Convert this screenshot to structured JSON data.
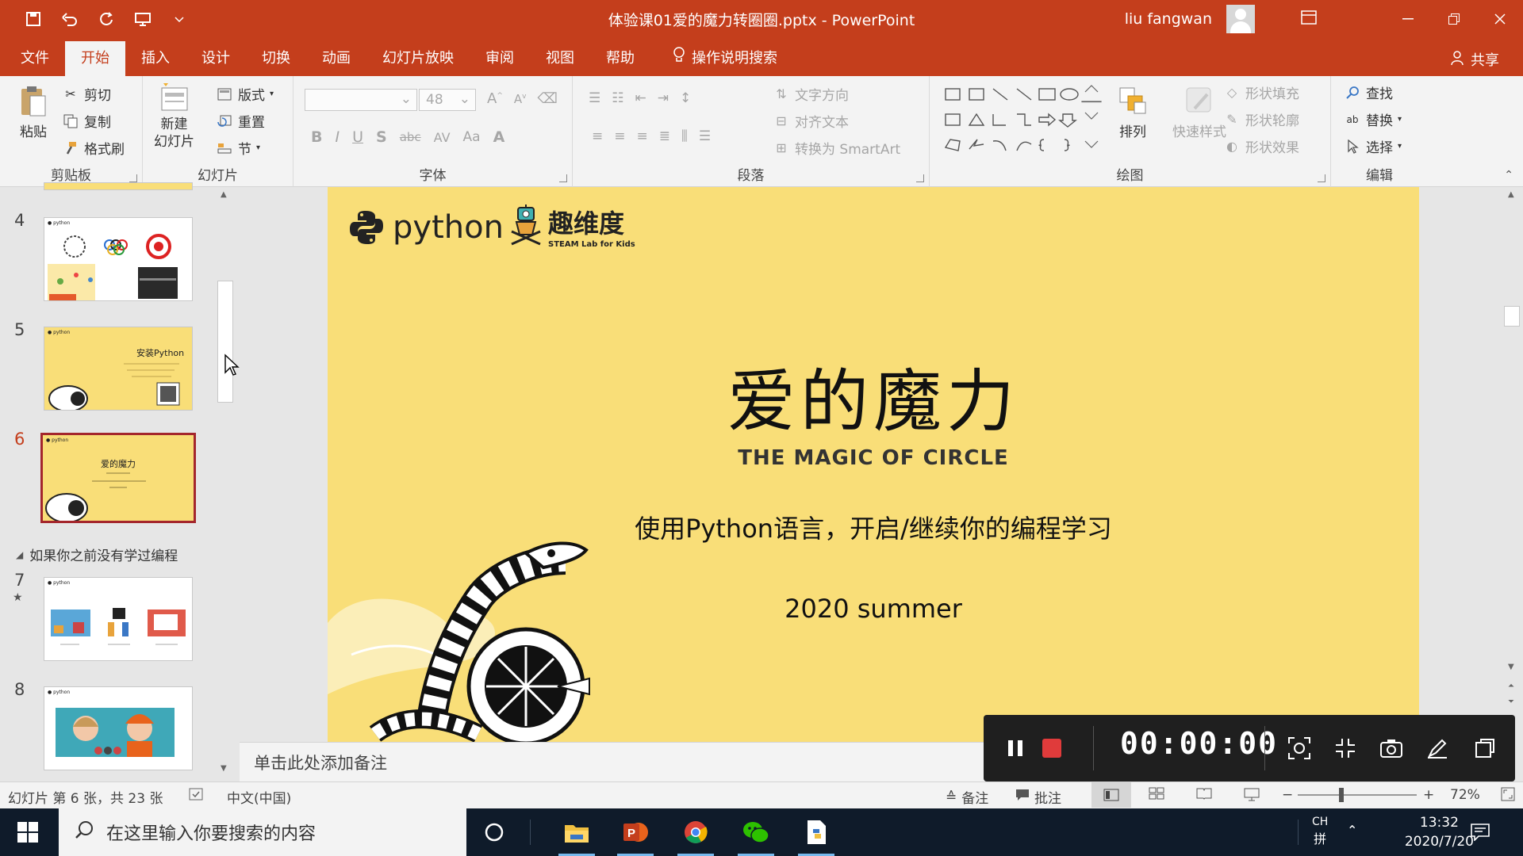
{
  "title_bar": {
    "document_title": "体验课01爱的魔力转圈圈.pptx  -  PowerPoint",
    "user_name": "liu fangwan"
  },
  "menu": {
    "tabs": [
      "文件",
      "开始",
      "插入",
      "设计",
      "切换",
      "动画",
      "幻灯片放映",
      "审阅",
      "视图",
      "帮助"
    ],
    "active_tab": "开始",
    "tell_me": "操作说明搜索",
    "share": "共享"
  },
  "ribbon": {
    "clipboard": {
      "paste": "粘贴",
      "cut": "剪切",
      "copy": "复制",
      "format_painter": "格式刷",
      "label": "剪贴板"
    },
    "slides": {
      "new_slide_line1": "新建",
      "new_slide_line2": "幻灯片",
      "layout": "版式",
      "reset": "重置",
      "section": "节",
      "label": "幻灯片"
    },
    "font": {
      "size_placeholder": "48",
      "label": "字体"
    },
    "paragraph": {
      "text_direction": "文字方向",
      "align_text": "对齐文本",
      "convert_smartart": "转换为 SmartArt",
      "label": "段落"
    },
    "drawing": {
      "arrange": "排列",
      "quick_styles": "快速样式",
      "shape_fill": "形状填充",
      "shape_outline": "形状轮廓",
      "shape_effects": "形状效果",
      "label": "绘图"
    },
    "editing": {
      "find": "查找",
      "replace": "替换",
      "select": "选择",
      "label": "编辑"
    }
  },
  "thumbnails": {
    "items": [
      {
        "number": "4"
      },
      {
        "number": "5",
        "title": "安装Python"
      },
      {
        "number": "6",
        "title": "爱的魔力",
        "selected": true
      },
      {
        "number": "7"
      },
      {
        "number": "8"
      }
    ],
    "section_name": "如果你之前没有学过编程"
  },
  "slide": {
    "logo_python": "python",
    "logo_brand": "趣维度",
    "logo_brand_sub": "STEAM Lab for Kids",
    "title": "爱的魔力",
    "subtitle": "THE MAGIC OF CIRCLE",
    "description": "使用Python语言，开启/继续你的编程学习",
    "date": "2020 summer"
  },
  "notes": {
    "placeholder": "单击此处添加备注"
  },
  "recorder": {
    "time": "00:00:00"
  },
  "status_bar": {
    "slide_info": "幻灯片 第 6 张，共 23 张",
    "language": "中文(中国)",
    "notes": "备注",
    "comments": "批注",
    "zoom": "72%"
  },
  "taskbar": {
    "search_placeholder": "在这里输入你要搜索的内容",
    "ime": "CH",
    "ime_mode": "拼",
    "time": "13:32",
    "date": "2020/7/20"
  },
  "colors": {
    "accent": "#c43e1c",
    "slide_bg": "#f9de78",
    "selected_thumb": "#a4262c",
    "recorder_stop": "#e03b3b"
  }
}
